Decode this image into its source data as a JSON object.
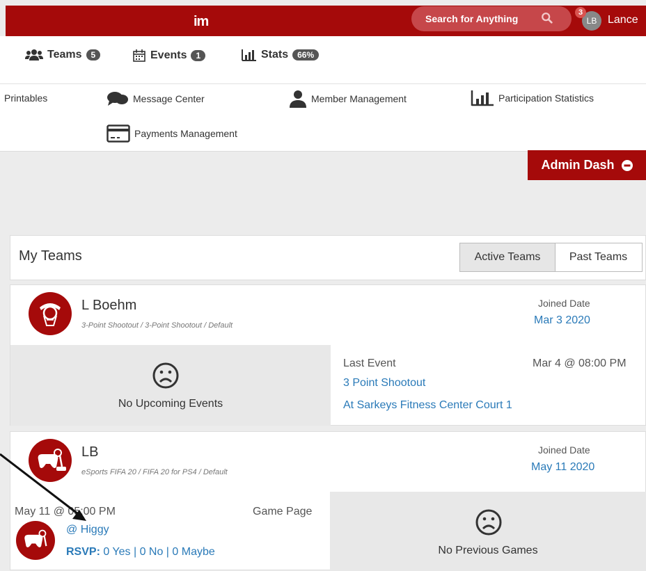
{
  "topbar": {
    "logo": "im",
    "search_label": "Search for Anything",
    "notif_count": "3",
    "avatar_initials": "LB",
    "username": "Lance"
  },
  "nav": {
    "teams": {
      "label": "Teams",
      "count": "5"
    },
    "events": {
      "label": "Events",
      "count": "1"
    },
    "stats": {
      "label": "Stats",
      "count": "66%"
    }
  },
  "menu": {
    "printables": "Printables",
    "message_center": "Message Center",
    "member_management": "Member Management",
    "participation_statistics": "Participation Statistics",
    "payments_management": "Payments Management"
  },
  "admin_dash": "Admin Dash",
  "my_teams": {
    "title": "My Teams",
    "active_tab": "Active Teams",
    "past_tab": "Past Teams"
  },
  "teams": [
    {
      "name": "L Boehm",
      "sub": "3-Point Shootout / 3-Point Shootout / Default",
      "joined_label": "Joined Date",
      "joined_date": "Mar 3 2020",
      "upcoming": "No Upcoming Events",
      "last_event_label": "Last Event",
      "last_event_time": "Mar 4 @ 08:00 PM",
      "last_event_name": "3 Point Shootout",
      "last_event_location": "At Sarkeys Fitness Center Court 1"
    },
    {
      "name": "LB",
      "sub": "eSports FIFA 20 / FIFA 20 for PS4 / Default",
      "joined_label": "Joined Date",
      "joined_date": "May 11 2020",
      "game_time": "May 11 @ 05:00 PM",
      "game_page": "Game Page",
      "opponent": "@ Higgy",
      "rsvp_label": "RSVP:",
      "rsvp_values": "0 Yes | 0 No | 0 Maybe",
      "previous": "No Previous Games"
    }
  ],
  "colors": {
    "brand": "#a50a0a",
    "link": "#2a7ab8"
  }
}
